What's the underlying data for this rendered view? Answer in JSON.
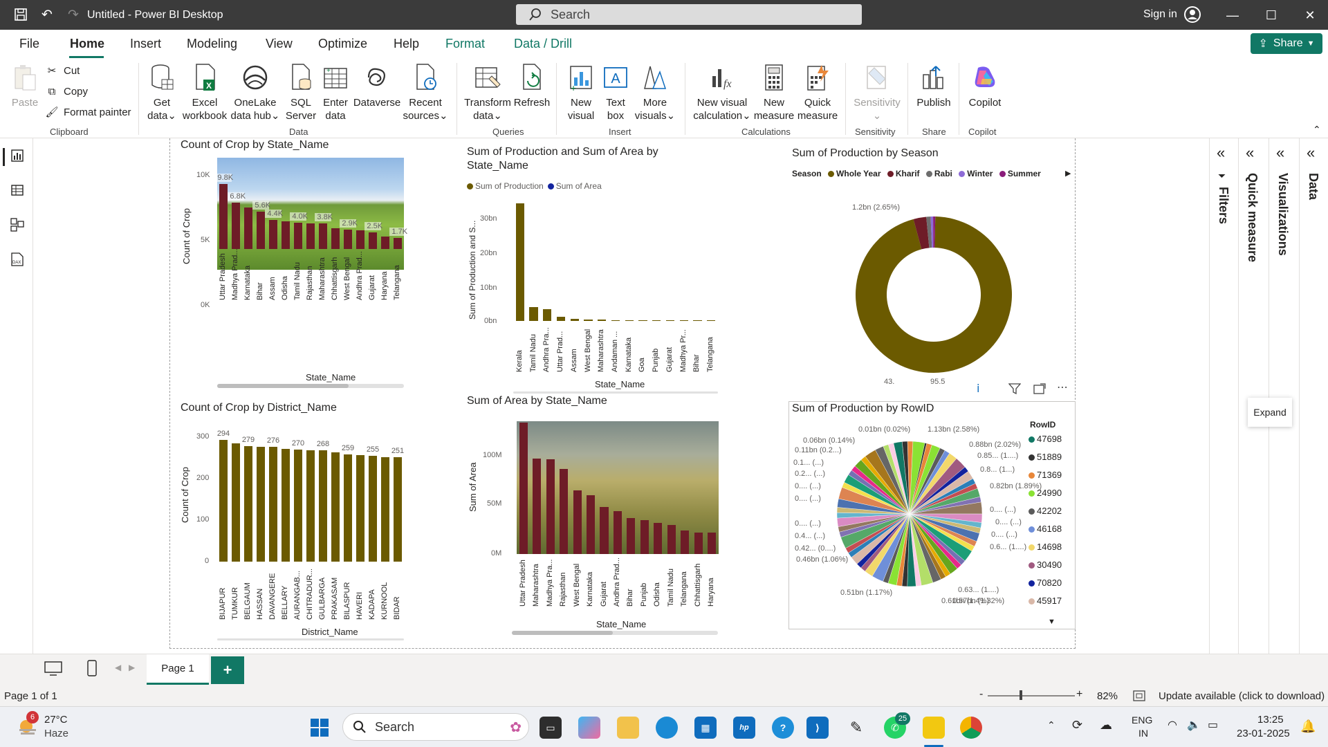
{
  "window": {
    "title": "Untitled - Power BI Desktop",
    "search_label": "Search",
    "signin": "Sign in"
  },
  "menu": {
    "items": [
      "File",
      "Home",
      "Insert",
      "Modeling",
      "View",
      "Optimize",
      "Help",
      "Format",
      "Data / Drill"
    ],
    "share": "Share"
  },
  "ribbon": {
    "clipboard": {
      "paste": "Paste",
      "cut": "Cut",
      "copy": "Copy",
      "format_painter": "Format painter",
      "label": "Clipboard"
    },
    "data": {
      "get_data": [
        "Get",
        "data"
      ],
      "excel": [
        "Excel",
        "workbook"
      ],
      "onelake": [
        "OneLake",
        "data hub"
      ],
      "sql": [
        "SQL",
        "Server"
      ],
      "enter": [
        "Enter",
        "data"
      ],
      "dataverse": [
        "Dataverse",
        ""
      ],
      "recent": [
        "Recent",
        "sources"
      ],
      "label": "Data"
    },
    "queries": {
      "transform": [
        "Transform",
        "data"
      ],
      "refresh": [
        "Refresh",
        ""
      ],
      "label": "Queries"
    },
    "insert": {
      "new_visual": [
        "New",
        "visual"
      ],
      "text_box": [
        "Text",
        "box"
      ],
      "more_visuals": [
        "More",
        "visuals"
      ],
      "label": "Insert"
    },
    "calculations": {
      "new_visual_calc": [
        "New visual",
        "calculation"
      ],
      "new_measure": [
        "New",
        "measure"
      ],
      "quick_measure": [
        "Quick",
        "measure"
      ],
      "label": "Calculations"
    },
    "sensitivity": {
      "btn": "Sensitivity",
      "label": "Sensitivity"
    },
    "share": {
      "publish": "Publish",
      "label": "Share"
    },
    "copilot": {
      "btn": "Copilot",
      "label": "Copilot"
    }
  },
  "colors": {
    "olive": "#6b5a00",
    "maroon": "#6e1c27",
    "accent": "#117865",
    "navy": "#12239e"
  },
  "charts": {
    "c1": {
      "title": "Count of Crop by State_Name",
      "xlabel": "State_Name",
      "ylabel": "Count of Crop",
      "ticks": [
        "10K",
        "5K",
        "0K"
      ],
      "categories": [
        "Uttar Pradesh",
        "Madhya Prad...",
        "Karnataka",
        "Bihar",
        "Assam",
        "Odisha",
        "Tamil Nadu",
        "Rajasthan",
        "Maharashtra",
        "Chhattisgarh",
        "West Bengal",
        "Andhra Prad...",
        "Gujarat",
        "Haryana",
        "Telangana"
      ],
      "values": [
        9.8,
        7.0,
        6.2,
        5.6,
        4.4,
        4.2,
        4.0,
        3.9,
        3.8,
        3.1,
        2.9,
        2.8,
        2.5,
        1.9,
        1.7
      ],
      "labels": [
        "9.8K",
        "6.8K",
        "",
        "5.6K",
        "4.4K",
        "",
        "4.0K",
        "",
        "3.8K",
        "",
        "2.9K",
        "",
        "2.5K",
        "",
        "1.7K"
      ]
    },
    "c2": {
      "title": "Sum of Production and Sum of Area by State_Name",
      "legend": [
        "Sum of Production",
        "Sum of Area"
      ],
      "xlabel": "State_Name",
      "ylabel": "Sum of Production and S...",
      "ticks": [
        "30bn",
        "20bn",
        "10bn",
        "0bn"
      ],
      "categories": [
        "Kerala",
        "Tamil Nadu",
        "Andhra Pra...",
        "Uttar Prad...",
        "Assam",
        "West Bengal",
        "Maharashtra",
        "Andaman ...",
        "Karnataka",
        "Goa",
        "Punjab",
        "Gujarat",
        "Madhya Pr...",
        "Bihar",
        "Telangana"
      ],
      "values": [
        34,
        4,
        3.5,
        1.2,
        0.6,
        0.5,
        0.4,
        0.3,
        0.25,
        0.2,
        0.2,
        0.15,
        0.15,
        0.1,
        0.1
      ]
    },
    "c3": {
      "title": "Sum of Production by Season",
      "legend_title": "Season",
      "legend": [
        "Whole Year",
        "Kharif",
        "Rabi",
        "Winter",
        "Summer"
      ],
      "lbl_top": "1.2bn (2.65%)",
      "lbl_bottom": "43.",
      "lbl_bottom2": "95.5",
      "values": [
        95.5,
        2.65,
        0.9,
        0.5,
        0.45
      ]
    },
    "c4": {
      "title": "Count of Crop by District_Name",
      "xlabel": "District_Name",
      "ylabel": "Count of Crop",
      "ticks": [
        "300",
        "200",
        "100",
        "0"
      ],
      "categories": [
        "BIJAPUR",
        "TUMKUR",
        "BELGAUM",
        "HASSAN",
        "DAVANGERE",
        "BELLARY",
        "AURANGAB...",
        "CHITRADUR...",
        "GULBARGA",
        "PRAKASAM",
        "BILASPUR",
        "HAVERI",
        "KADAPA",
        "KURNOOL",
        "BIDAR"
      ],
      "values": [
        294,
        285,
        279,
        277,
        276,
        271,
        270,
        269,
        268,
        264,
        259,
        257,
        255,
        252,
        251
      ],
      "labels": [
        "294",
        "",
        "279",
        "",
        "276",
        "",
        "270",
        "",
        "268",
        "",
        "259",
        "",
        "255",
        "",
        "251"
      ]
    },
    "c5": {
      "title": "Sum of Area by State_Name",
      "xlabel": "State_Name",
      "ylabel": "Sum of Area",
      "ticks": [
        "100M",
        "50M",
        "0M"
      ],
      "categories": [
        "Uttar Pradesh",
        "Maharashtra",
        "Madhya Pra...",
        "Rajasthan",
        "West Bengal",
        "Karnataka",
        "Gujarat",
        "Andhra Prad...",
        "Bihar",
        "Punjab",
        "Odisha",
        "Tamil Nadu",
        "Telangana",
        "Chhattisgarh",
        "Haryana"
      ],
      "values": [
        135,
        98,
        97,
        87,
        65,
        60,
        48,
        44,
        37,
        35,
        32,
        30,
        24,
        22,
        22
      ]
    },
    "c6": {
      "title": "Sum of Production by RowID",
      "legend_title": "RowID",
      "legend": [
        {
          "id": "47698",
          "color": "#117865"
        },
        {
          "id": "51889",
          "color": "#333333"
        },
        {
          "id": "71369",
          "color": "#e8873a"
        },
        {
          "id": "24990",
          "color": "#8ae234"
        },
        {
          "id": "42202",
          "color": "#5b5b5b"
        },
        {
          "id": "46168",
          "color": "#6f8fd9"
        },
        {
          "id": "14698",
          "color": "#f2d86b"
        },
        {
          "id": "30490",
          "color": "#a05a80"
        },
        {
          "id": "70820",
          "color": "#12239e"
        },
        {
          "id": "45917",
          "color": "#d9b8a8"
        }
      ],
      "labels": [
        "0.01bn (0.02%)",
        "1.13bn (2.58%)",
        "0.06bn (0.14%)",
        "0.88bn (2.02%)",
        "0.11bn (0.2...)",
        "0.85... (1....)",
        "0.1... (...)",
        "0.8... (1...)",
        "0.2... (...)",
        "0.82bn (1.89%)",
        "0.... (...)",
        "0.... (...)",
        "0.... (...)",
        "0.... (...)",
        "0.... (...)",
        "0.... (...)",
        "0.4... (...)",
        "0.6... (1....)",
        "0.42... (0....)",
        "0.63... (1....)",
        "0.46bn (1.06%)",
        "0.61bn (1.4%)",
        "0.51bn (1.17%)",
        "0.57bn (1.32%)"
      ]
    }
  },
  "panes": {
    "filters": "Filters",
    "quick_measure": "Quick measure",
    "visualizations": "Visualizations",
    "data": "Data",
    "tooltip": "Expand"
  },
  "pages": {
    "tab": "Page 1",
    "add": "+"
  },
  "status": {
    "page": "Page 1 of 1",
    "zoom": "82%",
    "update": "Update available (click to download)"
  },
  "taskbar": {
    "weather_temp": "27°C",
    "weather_desc": "Haze",
    "weather_badge": "6",
    "search": "Search",
    "lang1": "ENG",
    "lang2": "IN",
    "time": "13:25",
    "date": "23-01-2025",
    "badge": "25"
  }
}
